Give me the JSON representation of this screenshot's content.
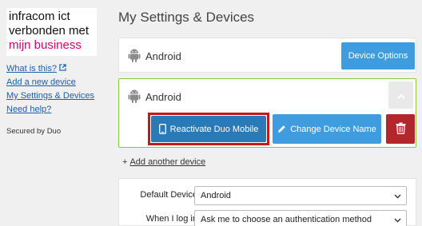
{
  "logo": {
    "line1": "infracom ict",
    "line2": "verbonden met",
    "line3": "mijn business",
    "colors": {
      "text": "#111111",
      "accent": "#d40078"
    }
  },
  "nav": {
    "items": [
      {
        "label": "What is this?",
        "icon": "external-link-icon"
      },
      {
        "label": "Add a new device"
      },
      {
        "label": "My Settings & Devices"
      },
      {
        "label": "Need help?"
      }
    ],
    "secured_by": "Secured by Duo"
  },
  "main": {
    "title": "My Settings & Devices",
    "devices": [
      {
        "name": "Android",
        "icon": "android-icon",
        "options_label": "Device Options"
      },
      {
        "name": "Android",
        "icon": "android-icon",
        "expanded": true,
        "reactivate_label": "Reactivate Duo Mobile",
        "rename_label": "Change Device Name",
        "delete_icon": "trash-icon"
      }
    ],
    "add_another": {
      "prefix": "+",
      "label": "Add another device"
    },
    "settings": {
      "default_device": {
        "label": "Default Device:",
        "value": "Android"
      },
      "when_login": {
        "label": "When I log in:",
        "value": "Ask me to choose an authentication method"
      }
    }
  },
  "colors": {
    "primary_button": "#3f9ddf",
    "highlighted_button": "#2a7ab8",
    "danger_button": "#b3262b",
    "highlight_border": "#c8161d",
    "active_card_border": "#8cc63f",
    "link": "#1a5ea8"
  }
}
